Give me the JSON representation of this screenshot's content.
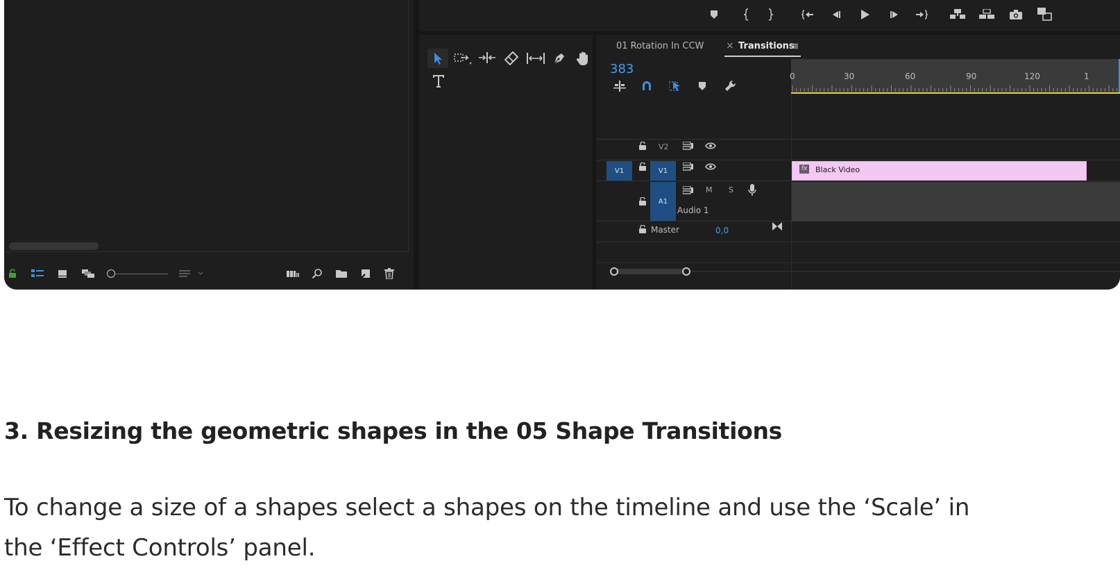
{
  "timeline": {
    "tabs": [
      {
        "label": "01 Rotation In CCW",
        "active": false
      },
      {
        "label": "Transitions",
        "active": true
      }
    ],
    "close_glyph": "×",
    "menu_glyph": "≡",
    "timecode": "383",
    "ruler_ticks": [
      "0",
      "30",
      "60",
      "90",
      "120",
      "1"
    ],
    "tracks": {
      "v2": {
        "label": "V2"
      },
      "v1": {
        "source": "V1",
        "label": "V1"
      },
      "a1": {
        "label": "A1",
        "name": "Audio 1",
        "mute": "M",
        "solo": "S"
      },
      "master": {
        "label": "Master",
        "value": "0,0"
      }
    },
    "clip": {
      "fx": "fx",
      "name": "Black Video",
      "color": "#f3c8f3"
    },
    "accent": "#3f8ee0",
    "work_area_color": "#e7d340"
  },
  "article": {
    "heading": "3. Resizing the geometric shapes in the 05 Shape Transitions",
    "paragraph": "To change a size of a shapes select a shapes on the timeline and use the ‘Scale’ in the ‘Effect Controls’ panel."
  }
}
